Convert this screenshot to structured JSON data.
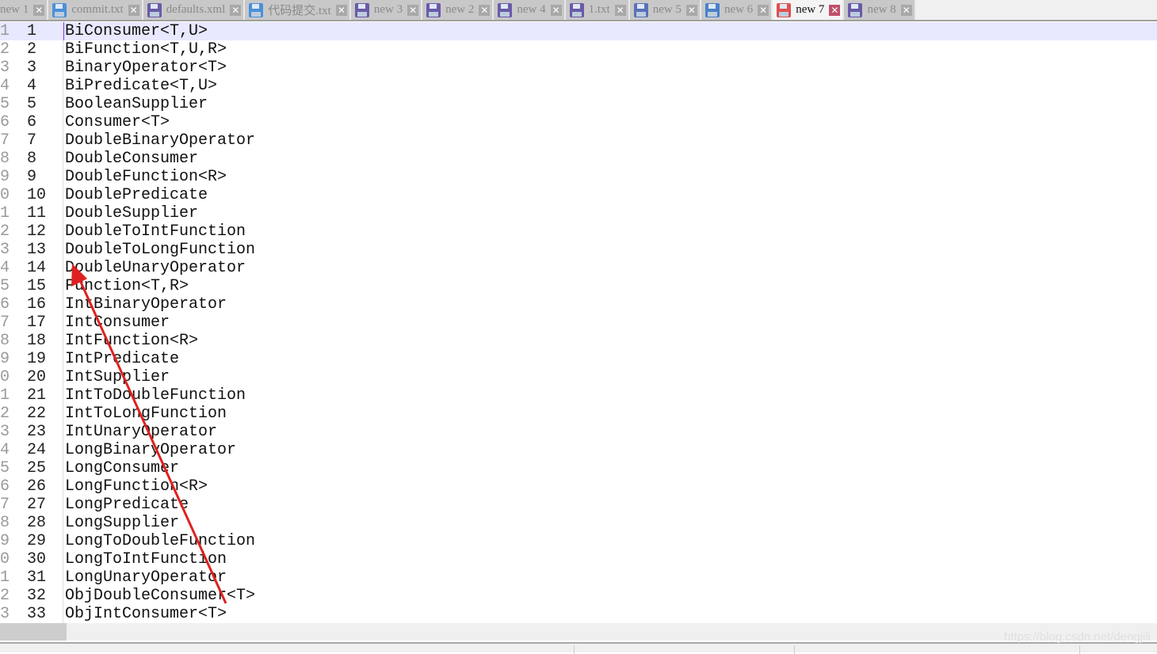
{
  "tabs": [
    {
      "label": "new 1",
      "icon": "none",
      "active": false
    },
    {
      "label": "commit.txt",
      "icon": "#4a90d9"
    },
    {
      "label": "defaults.xml",
      "icon": "#6a5aa8"
    },
    {
      "label": "代码提交.txt",
      "icon": "#4a90d9"
    },
    {
      "label": "new 3",
      "icon": "#6a5aa8"
    },
    {
      "label": "new 2",
      "icon": "#6a5aa8"
    },
    {
      "label": "new 4",
      "icon": "#6a5aa8"
    },
    {
      "label": "1.txt",
      "icon": "#6a5aa8"
    },
    {
      "label": "new 5",
      "icon": "#5a70b8"
    },
    {
      "label": "new 6",
      "icon": "#4a80c8"
    },
    {
      "label": "new 7",
      "icon": "#e05050",
      "active": true
    },
    {
      "label": "new 8",
      "icon": "#6a5aa8"
    }
  ],
  "close_glyph": "✕",
  "lines": [
    {
      "outer": "1",
      "num": "1",
      "text": "BiConsumer<T,U>"
    },
    {
      "outer": "2",
      "num": "2",
      "text": "BiFunction<T,U,R>"
    },
    {
      "outer": "3",
      "num": "3",
      "text": "BinaryOperator<T>"
    },
    {
      "outer": "4",
      "num": "4",
      "text": "BiPredicate<T,U>"
    },
    {
      "outer": "5",
      "num": "5",
      "text": "BooleanSupplier"
    },
    {
      "outer": "6",
      "num": "6",
      "text": "Consumer<T>"
    },
    {
      "outer": "7",
      "num": "7",
      "text": "DoubleBinaryOperator"
    },
    {
      "outer": "8",
      "num": "8",
      "text": "DoubleConsumer"
    },
    {
      "outer": "9",
      "num": "9",
      "text": "DoubleFunction<R>"
    },
    {
      "outer": "0",
      "num": "10",
      "text": "DoublePredicate"
    },
    {
      "outer": "1",
      "num": "11",
      "text": "DoubleSupplier"
    },
    {
      "outer": "2",
      "num": "12",
      "text": "DoubleToIntFunction"
    },
    {
      "outer": "3",
      "num": "13",
      "text": "DoubleToLongFunction"
    },
    {
      "outer": "4",
      "num": "14",
      "text": "DoubleUnaryOperator"
    },
    {
      "outer": "5",
      "num": "15",
      "text": "Function<T,R>"
    },
    {
      "outer": "6",
      "num": "16",
      "text": "IntBinaryOperator"
    },
    {
      "outer": "7",
      "num": "17",
      "text": "IntConsumer"
    },
    {
      "outer": "8",
      "num": "18",
      "text": "IntFunction<R>"
    },
    {
      "outer": "9",
      "num": "19",
      "text": "IntPredicate"
    },
    {
      "outer": "0",
      "num": "20",
      "text": "IntSupplier"
    },
    {
      "outer": "1",
      "num": "21",
      "text": "IntToDoubleFunction"
    },
    {
      "outer": "2",
      "num": "22",
      "text": "IntToLongFunction"
    },
    {
      "outer": "3",
      "num": "23",
      "text": "IntUnaryOperator"
    },
    {
      "outer": "4",
      "num": "24",
      "text": "LongBinaryOperator"
    },
    {
      "outer": "5",
      "num": "25",
      "text": "LongConsumer"
    },
    {
      "outer": "6",
      "num": "26",
      "text": "LongFunction<R>"
    },
    {
      "outer": "7",
      "num": "27",
      "text": "LongPredicate"
    },
    {
      "outer": "8",
      "num": "28",
      "text": "LongSupplier"
    },
    {
      "outer": "9",
      "num": "29",
      "text": "LongToDoubleFunction"
    },
    {
      "outer": "0",
      "num": "30",
      "text": "LongToIntFunction"
    },
    {
      "outer": "1",
      "num": "31",
      "text": "LongUnaryOperator"
    },
    {
      "outer": "2",
      "num": "32",
      "text": "ObjDoubleConsumer<T>"
    },
    {
      "outer": "3",
      "num": "33",
      "text": "ObjIntConsumer<T>"
    }
  ],
  "watermark": "https://blog.csdn.net/dengjili",
  "annotation_color": "#e02020"
}
